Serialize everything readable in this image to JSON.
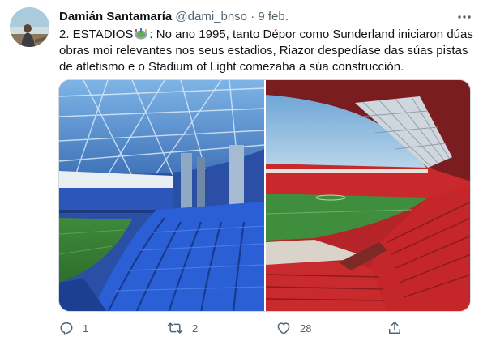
{
  "tweet": {
    "author_name": "Damián Santamaría",
    "handle": "@dami_bnso",
    "separator": "·",
    "date": "9 feb.",
    "text_before_emoji": "2. ESTADIOS",
    "emoji": "stadium-emoji",
    "text_after_emoji": ": No ano 1995, tanto Dépor como Sunderland iniciaron dúas obras moi relevantes nos seus estadios, Riazor despedíase das súas pistas de atletismo e o Stadium of Light comezaba a súa construcción."
  },
  "media": {
    "photos": [
      "riazor-stadium-photo",
      "stadium-of-light-photo"
    ]
  },
  "actions": {
    "reply_count": "1",
    "retweet_count": "2",
    "like_count": "28"
  },
  "icons": [
    "more-icon",
    "reply-icon",
    "retweet-icon",
    "like-icon",
    "share-icon"
  ],
  "colors": {
    "text": "#0f1419",
    "secondary": "#536471",
    "border": "#cfd9de",
    "riazor_seats": "#2f5bd0",
    "sunderland_seats": "#c8262a"
  }
}
